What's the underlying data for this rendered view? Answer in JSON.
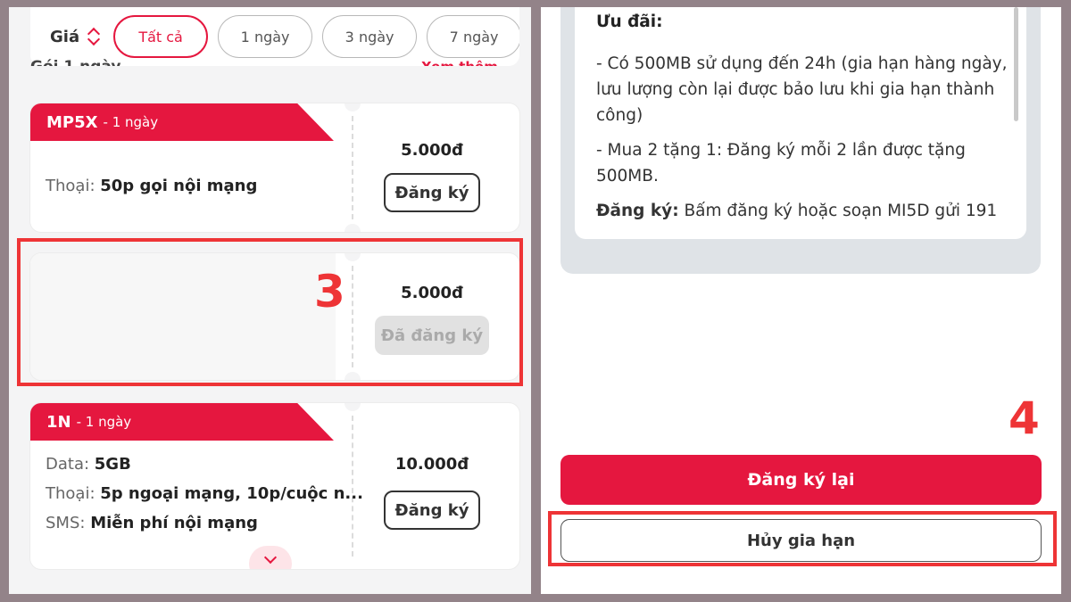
{
  "filter": {
    "label": "Giá",
    "chips": [
      "Tất cả",
      "1 ngày",
      "3 ngày",
      "7 ngày"
    ]
  },
  "section": {
    "title": "Gói 1 ngày",
    "link": "Xem thêm"
  },
  "packages": [
    {
      "code": "MP5X",
      "duration": "- 1 ngày",
      "lines": [
        {
          "label": "Thoại:",
          "value": "50p gọi nội mạng"
        }
      ],
      "price": "5.000đ",
      "button": "Đăng ký"
    },
    {
      "price": "5.000đ",
      "button": "Đã đăng ký"
    },
    {
      "code": "1N",
      "duration": "- 1 ngày",
      "lines": [
        {
          "label": "Data:",
          "value": "5GB"
        },
        {
          "label": "Thoại:",
          "value": "5p ngoại mạng, 10p/cuộc n..."
        },
        {
          "label": "SMS:",
          "value": "Miễn phí nội mạng"
        }
      ],
      "price": "10.000đ",
      "button": "Đăng ký"
    }
  ],
  "annotations": {
    "step3": "3",
    "step4": "4",
    "highlight_color": "#ee3436"
  },
  "details": {
    "heading": "Ưu đãi:",
    "items": [
      "- Có 500MB sử dụng đến 24h (gia hạn hàng ngày, lưu lượng còn lại được bảo lưu khi gia hạn thành công)",
      "- Mua 2 tặng 1: Đăng ký mỗi 2 lần được tặng 500MB."
    ],
    "register_label": "Đăng ký:",
    "register_text": " Bấm đăng ký hoặc soạn MI5D gửi 191"
  },
  "actions": {
    "renew": "Đăng ký lại",
    "cancel": "Hủy gia hạn"
  },
  "colors": {
    "brand": "#e5173f",
    "background": "#938389"
  }
}
